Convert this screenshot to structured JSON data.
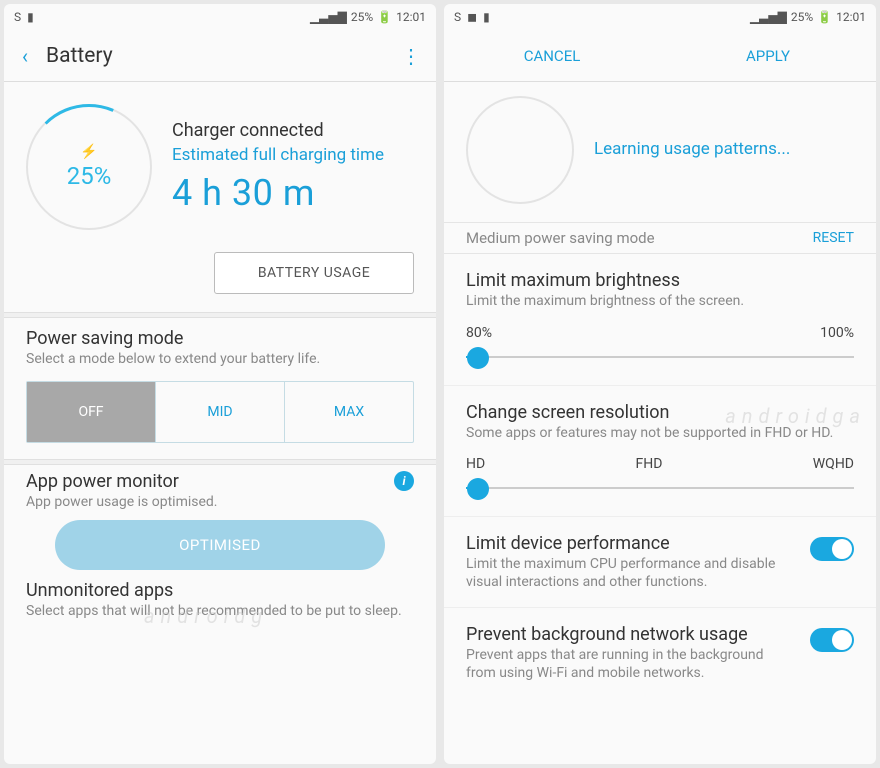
{
  "statusbar": {
    "pct": "25%",
    "time": "12:01",
    "s": "S"
  },
  "left": {
    "title": "Battery",
    "charge": {
      "pct": "25%",
      "connected": "Charger connected",
      "est_label": "Estimated full charging time",
      "time": "4 h 30 m",
      "usage_btn": "BATTERY USAGE"
    },
    "psm": {
      "title": "Power saving mode",
      "sub": "Select a mode below to extend your battery life.",
      "off": "OFF",
      "mid": "MID",
      "max": "MAX"
    },
    "apm": {
      "title": "App power monitor",
      "sub": "App power usage is optimised.",
      "btn": "OPTIMISED"
    },
    "un": {
      "title": "Unmonitored apps",
      "sub": "Select apps that will not be recommended to be put to sleep."
    }
  },
  "right": {
    "cancel": "CANCEL",
    "apply": "APPLY",
    "patterns": "Learning usage patterns...",
    "mode": "Medium power saving mode",
    "reset": "RESET",
    "brightness": {
      "title": "Limit maximum brightness",
      "sub": "Limit the maximum brightness of the screen.",
      "low": "80%",
      "high": "100%"
    },
    "res": {
      "title": "Change screen resolution",
      "sub": "Some apps or features may not be supported in FHD or HD.",
      "hd": "HD",
      "fhd": "FHD",
      "wqhd": "WQHD"
    },
    "perf": {
      "title": "Limit device performance",
      "sub": "Limit the maximum CPU performance and disable visual interactions and other functions."
    },
    "bg": {
      "title": "Prevent background network usage",
      "sub": "Prevent apps that are running in the background from using Wi-Fi and mobile networks."
    }
  }
}
